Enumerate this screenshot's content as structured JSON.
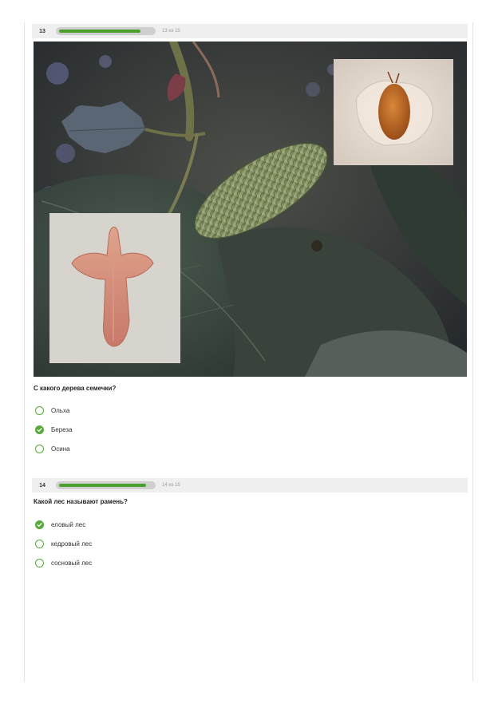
{
  "questions": [
    {
      "number": "13",
      "progress_text": "13 из 15",
      "progress_fraction": 0.87,
      "question": "С какого дерева семечки?",
      "options": [
        {
          "label": "Ольха",
          "checked": false
        },
        {
          "label": "Береза",
          "checked": true
        },
        {
          "label": "Осина",
          "checked": false
        }
      ]
    },
    {
      "number": "14",
      "progress_text": "14 из 15",
      "progress_fraction": 0.93,
      "question": "Какой лес называют рамень?",
      "options": [
        {
          "label": "еловый лес",
          "checked": true
        },
        {
          "label": "кедровый лес",
          "checked": false
        },
        {
          "label": "сосновый лес",
          "checked": false
        }
      ]
    }
  ],
  "icons": {
    "checked": "check-icon",
    "unchecked": "radio-empty-icon"
  },
  "colors": {
    "accent": "#58a83a",
    "progress_fill": "#4aa02c",
    "progress_track": "#cfcfcf",
    "bar_bg": "#efefef"
  }
}
